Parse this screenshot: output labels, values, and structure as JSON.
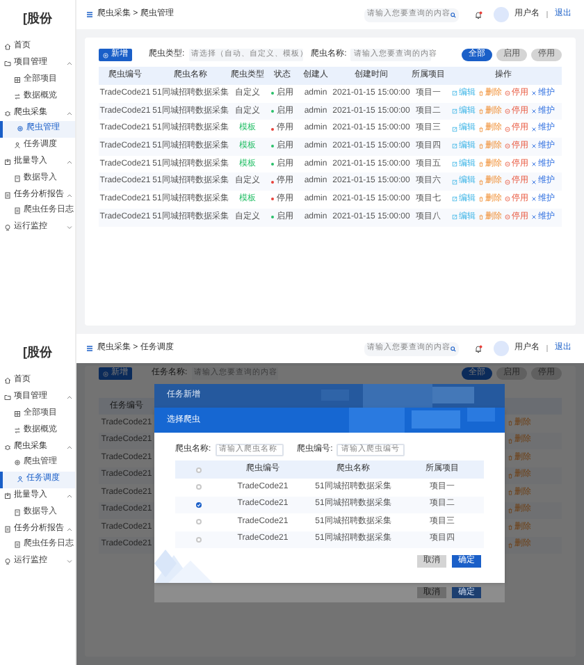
{
  "screens": [
    {
      "kind": "list",
      "logo": "[股份",
      "sidebar": [
        {
          "label": "首页",
          "selected": false
        },
        {
          "label": "项目管理",
          "expanded": true,
          "children": [
            {
              "label": "全部项目",
              "selected": false
            },
            {
              "label": "数据概览",
              "selected": false
            }
          ]
        },
        {
          "label": "爬虫采集",
          "expanded": true,
          "children": [
            {
              "label": "爬虫管理",
              "selected": true
            },
            {
              "label": "任务调度",
              "selected": false
            }
          ]
        },
        {
          "label": "批量导入",
          "expanded": true,
          "children": [
            {
              "label": "数据导入",
              "selected": false
            }
          ]
        },
        {
          "label": "任务分析报告",
          "expanded": true,
          "children": [
            {
              "label": "爬虫任务日志",
              "selected": false
            }
          ]
        },
        {
          "label": "运行监控",
          "expanded": false
        }
      ],
      "header": {
        "breadcrumb": "爬虫采集 > 爬虫管理",
        "search_placeholder": "请输入您要查询的内容",
        "unread": true,
        "user_name": "用户名",
        "logout": "退出"
      },
      "toolbar": {
        "add_button": "新增",
        "filters": [
          {
            "kind": "select",
            "label": "爬虫类型:",
            "placeholder": "请选择（自动、自定义、模板）"
          },
          {
            "kind": "input",
            "label": "爬虫名称:",
            "placeholder": "请输入您要查询的内容"
          }
        ],
        "status_tabs": [
          {
            "label": "全部",
            "selected": true
          },
          {
            "label": "启用",
            "selected": false
          },
          {
            "label": "停用",
            "selected": false
          }
        ]
      },
      "table": {
        "columns": [
          "爬虫编号",
          "爬虫名称",
          "爬虫类型",
          "状态",
          "创建人",
          "创建时间",
          "所属项目",
          "操作"
        ],
        "rows": [
          {
            "code": "TradeCode21",
            "name": "51同城招聘数据采集",
            "type": "自定义",
            "status": "启用",
            "enabled": true,
            "creator": "admin",
            "created": "2021-01-15 15:00:00",
            "project": "项目一",
            "actions": [
              "编辑",
              "删除",
              "停用",
              "维护"
            ]
          },
          {
            "code": "TradeCode21",
            "name": "51同城招聘数据采集",
            "type": "自定义",
            "status": "启用",
            "enabled": true,
            "creator": "admin",
            "created": "2021-01-15 15:00:00",
            "project": "项目二",
            "actions": [
              "编辑",
              "删除",
              "停用",
              "维护"
            ]
          },
          {
            "code": "TradeCode21",
            "name": "51同城招聘数据采集",
            "type": "模板",
            "status": "停用",
            "enabled": false,
            "creator": "admin",
            "created": "2021-01-15 15:00:00",
            "project": "项目三",
            "actions": [
              "编辑",
              "删除",
              "停用",
              "维护"
            ]
          },
          {
            "code": "TradeCode21",
            "name": "51同城招聘数据采集",
            "type": "模板",
            "status": "启用",
            "enabled": true,
            "creator": "admin",
            "created": "2021-01-15 15:00:00",
            "project": "项目四",
            "actions": [
              "编辑",
              "删除",
              "停用",
              "维护"
            ]
          },
          {
            "code": "TradeCode21",
            "name": "51同城招聘数据采集",
            "type": "模板",
            "status": "启用",
            "enabled": true,
            "creator": "admin",
            "created": "2021-01-15 15:00:00",
            "project": "项目五",
            "actions": [
              "编辑",
              "删除",
              "停用",
              "维护"
            ]
          },
          {
            "code": "TradeCode21",
            "name": "51同城招聘数据采集",
            "type": "自定义",
            "status": "停用",
            "enabled": false,
            "creator": "admin",
            "created": "2021-01-15 15:00:00",
            "project": "项目六",
            "actions": [
              "编辑",
              "删除",
              "停用",
              "维护"
            ]
          },
          {
            "code": "TradeCode21",
            "name": "51同城招聘数据采集",
            "type": "模板",
            "status": "停用",
            "enabled": false,
            "creator": "admin",
            "created": "2021-01-15 15:00:00",
            "project": "项目七",
            "actions": [
              "编辑",
              "删除",
              "停用",
              "维护"
            ]
          },
          {
            "code": "TradeCode21",
            "name": "51同城招聘数据采集",
            "type": "自定义",
            "status": "启用",
            "enabled": true,
            "creator": "admin",
            "created": "2021-01-15 15:00:00",
            "project": "项目八",
            "actions": [
              "编辑",
              "删除",
              "停用",
              "维护"
            ]
          }
        ]
      }
    },
    {
      "kind": "modal",
      "logo": "[股份",
      "sidebar": [
        {
          "label": "首页",
          "selected": false
        },
        {
          "label": "项目管理",
          "expanded": true,
          "children": [
            {
              "label": "全部项目",
              "selected": false
            },
            {
              "label": "数据概览",
              "selected": false
            }
          ]
        },
        {
          "label": "爬虫采集",
          "expanded": true,
          "children": [
            {
              "label": "爬虫管理",
              "selected": false
            },
            {
              "label": "任务调度",
              "selected": true
            }
          ]
        },
        {
          "label": "批量导入",
          "expanded": true,
          "children": [
            {
              "label": "数据导入",
              "selected": false
            }
          ]
        },
        {
          "label": "任务分析报告",
          "expanded": true,
          "children": [
            {
              "label": "爬虫任务日志",
              "selected": false
            }
          ]
        },
        {
          "label": "运行监控",
          "expanded": false
        }
      ],
      "header": {
        "breadcrumb": "爬虫采集 > 任务调度",
        "search_placeholder": "请输入您要查询的内容",
        "unread": true,
        "user_name": "用户名",
        "logout": "退出"
      },
      "background": {
        "add_button": "新增",
        "filter_label": "任务名称:",
        "filter_placeholder": "请输入您要查询的内容",
        "status_tabs": [
          {
            "label": "全部",
            "selected": true
          },
          {
            "label": "启用",
            "selected": false
          },
          {
            "label": "停用",
            "selected": false
          }
        ],
        "column": "任务编号",
        "rows": [
          {
            "code": "TradeCode21",
            "action": "删除"
          },
          {
            "code": "TradeCode21",
            "action": "删除"
          },
          {
            "code": "TradeCode21",
            "action": "删除"
          },
          {
            "code": "TradeCode21",
            "action": "删除"
          },
          {
            "code": "TradeCode21",
            "action": "删除"
          },
          {
            "code": "TradeCode21",
            "action": "删除"
          },
          {
            "code": "TradeCode21",
            "action": "删除"
          },
          {
            "code": "TradeCode21",
            "action": "删除"
          }
        ]
      },
      "outer_dialog": {
        "title": "任务新增",
        "buttons": [
          "取消",
          "确定"
        ]
      },
      "dialog": {
        "title": "选择爬虫",
        "fields": [
          {
            "label": "爬虫名称:",
            "placeholder": "请输入爬虫名称"
          },
          {
            "label": "爬虫编号:",
            "placeholder": "请输入爬虫编号"
          }
        ],
        "all_selected": false,
        "columns": [
          "爬虫编号",
          "爬虫名称",
          "所属项目"
        ],
        "rows": [
          {
            "selected": false,
            "code": "TradeCode21",
            "name": "51同城招聘数据采集",
            "project": "项目一"
          },
          {
            "selected": true,
            "code": "TradeCode21",
            "name": "51同城招聘数据采集",
            "project": "项目二"
          },
          {
            "selected": false,
            "code": "TradeCode21",
            "name": "51同城招聘数据采集",
            "project": "项目三"
          },
          {
            "selected": false,
            "code": "TradeCode21",
            "name": "51同城招聘数据采集",
            "project": "项目四"
          }
        ],
        "cancel": "取消",
        "confirm": "确定"
      }
    }
  ]
}
